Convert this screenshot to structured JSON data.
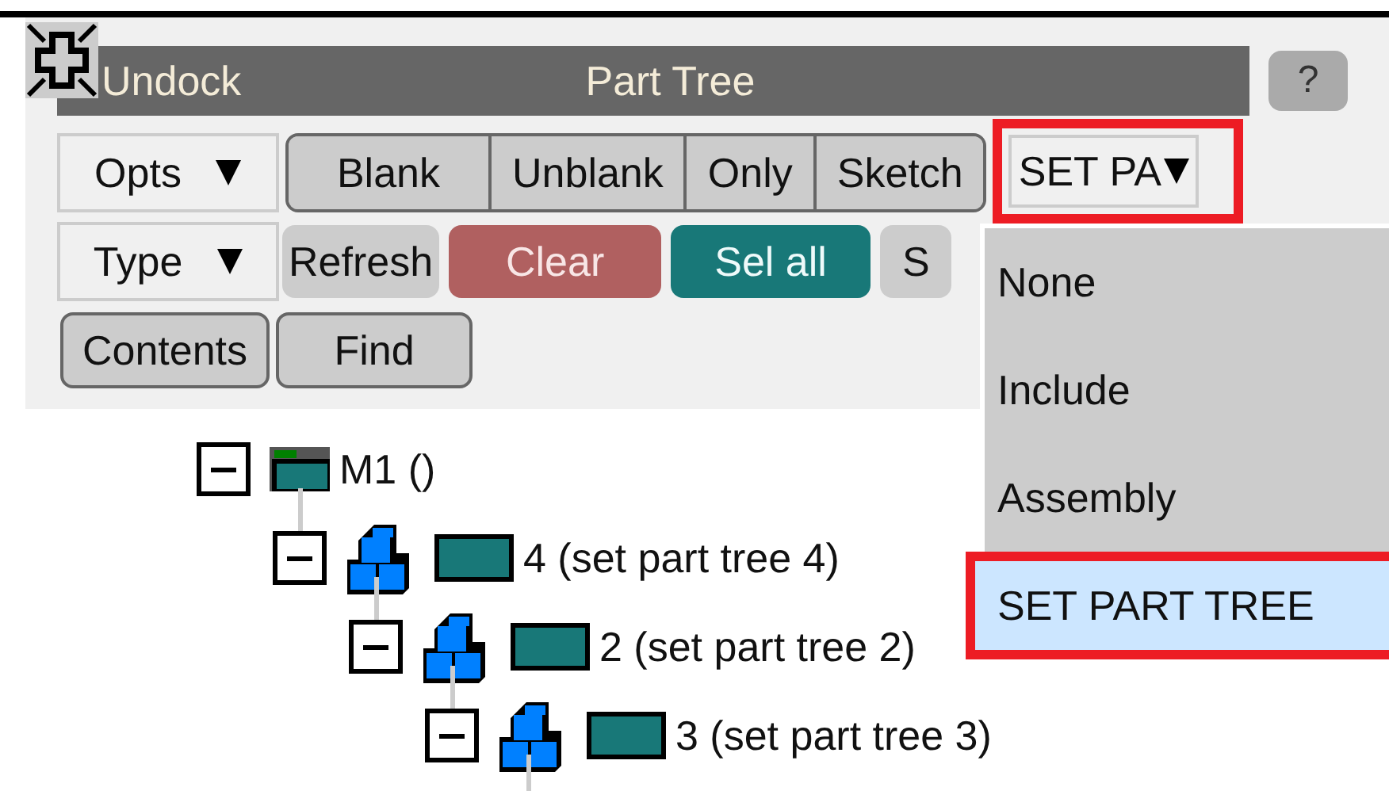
{
  "panel": {
    "undock_label": "Undock",
    "title": "Part Tree",
    "help": "?"
  },
  "toolbar": {
    "row_1": {
      "dropdown": {
        "label": "Opts"
      },
      "buttons": [
        {
          "label": "Blank"
        },
        {
          "label": "Unblank"
        },
        {
          "label": "Only"
        },
        {
          "label": "Sketch"
        }
      ],
      "set_dropdown": {
        "label": "SET PA",
        "highlighted": true
      }
    },
    "row_2": {
      "dropdown": {
        "label": "Type"
      },
      "buttons": [
        {
          "label": "Refresh",
          "kind": "flat"
        },
        {
          "label": "Clear",
          "kind": "danger"
        },
        {
          "label": "Sel all",
          "kind": "accent"
        },
        {
          "label": "S",
          "kind": "flat"
        }
      ]
    },
    "row_3": {
      "buttons": [
        {
          "label": "Contents"
        },
        {
          "label": "Find"
        }
      ]
    }
  },
  "menu": {
    "items": [
      {
        "label": "None",
        "selected": false,
        "highlighted": false
      },
      {
        "label": "Include",
        "selected": false,
        "highlighted": false
      },
      {
        "label": "Assembly",
        "selected": false,
        "highlighted": false
      },
      {
        "label": "SET PART TREE",
        "selected": true,
        "highlighted": true
      }
    ]
  },
  "tree": [
    {
      "label": "M1 ()",
      "kind": "model",
      "expanded": true,
      "children": [
        {
          "label": "4 (set part tree 4)",
          "kind": "set",
          "expanded": true,
          "children": [
            {
              "label": "2 (set part tree 2)",
              "kind": "set",
              "expanded": true,
              "children": [
                {
                  "label": "3 (set part tree 3)",
                  "kind": "set",
                  "expanded": true
                }
              ]
            }
          ]
        }
      ]
    }
  ]
}
